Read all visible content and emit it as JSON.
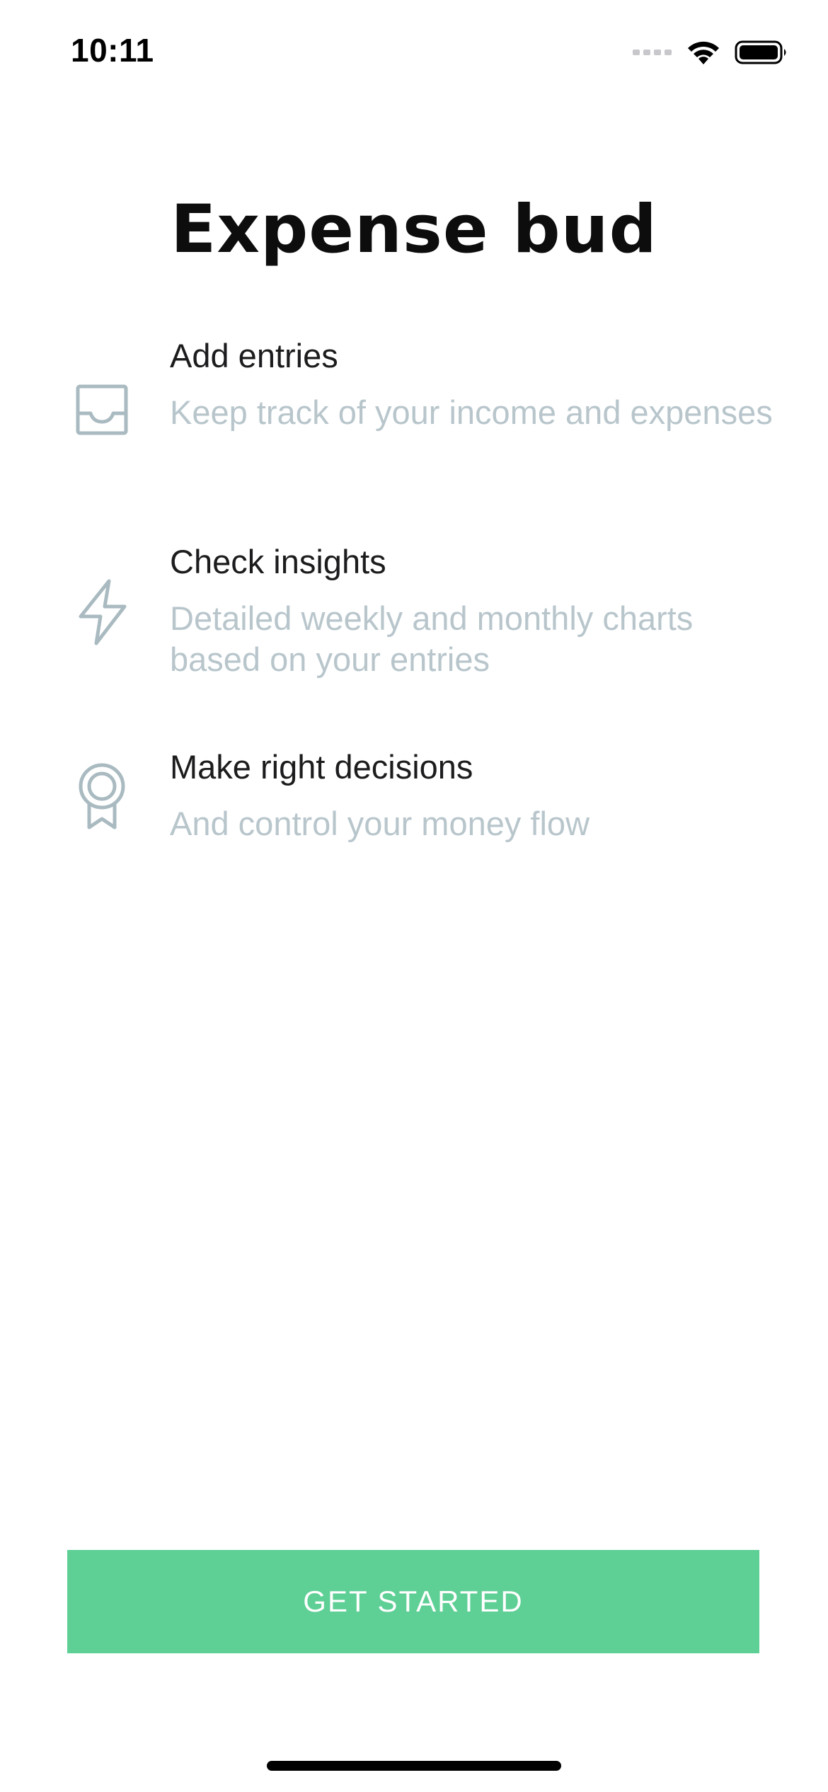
{
  "status_bar": {
    "time": "10:11",
    "icons": [
      "signal-icon",
      "wifi-icon",
      "battery-icon"
    ]
  },
  "app": {
    "title": "Expense bud"
  },
  "features": [
    {
      "icon": "inbox-tray-icon",
      "title": "Add entries",
      "description": "Keep track of your income and expenses"
    },
    {
      "icon": "lightning-bolt-icon",
      "title": "Check insights",
      "description": "Detailed weekly and monthly charts based on your entries"
    },
    {
      "icon": "award-ribbon-icon",
      "title": "Make right decisions",
      "description": "And control your money flow"
    }
  ],
  "button": {
    "label": "GET STARTED"
  },
  "colors": {
    "accent": "#5ecf95",
    "title_text": "#0d0d0d",
    "feature_title": "#1c1c1e",
    "feature_desc": "#b8c6cc",
    "icon_stroke": "#a9bac0",
    "background": "#ffffff"
  }
}
